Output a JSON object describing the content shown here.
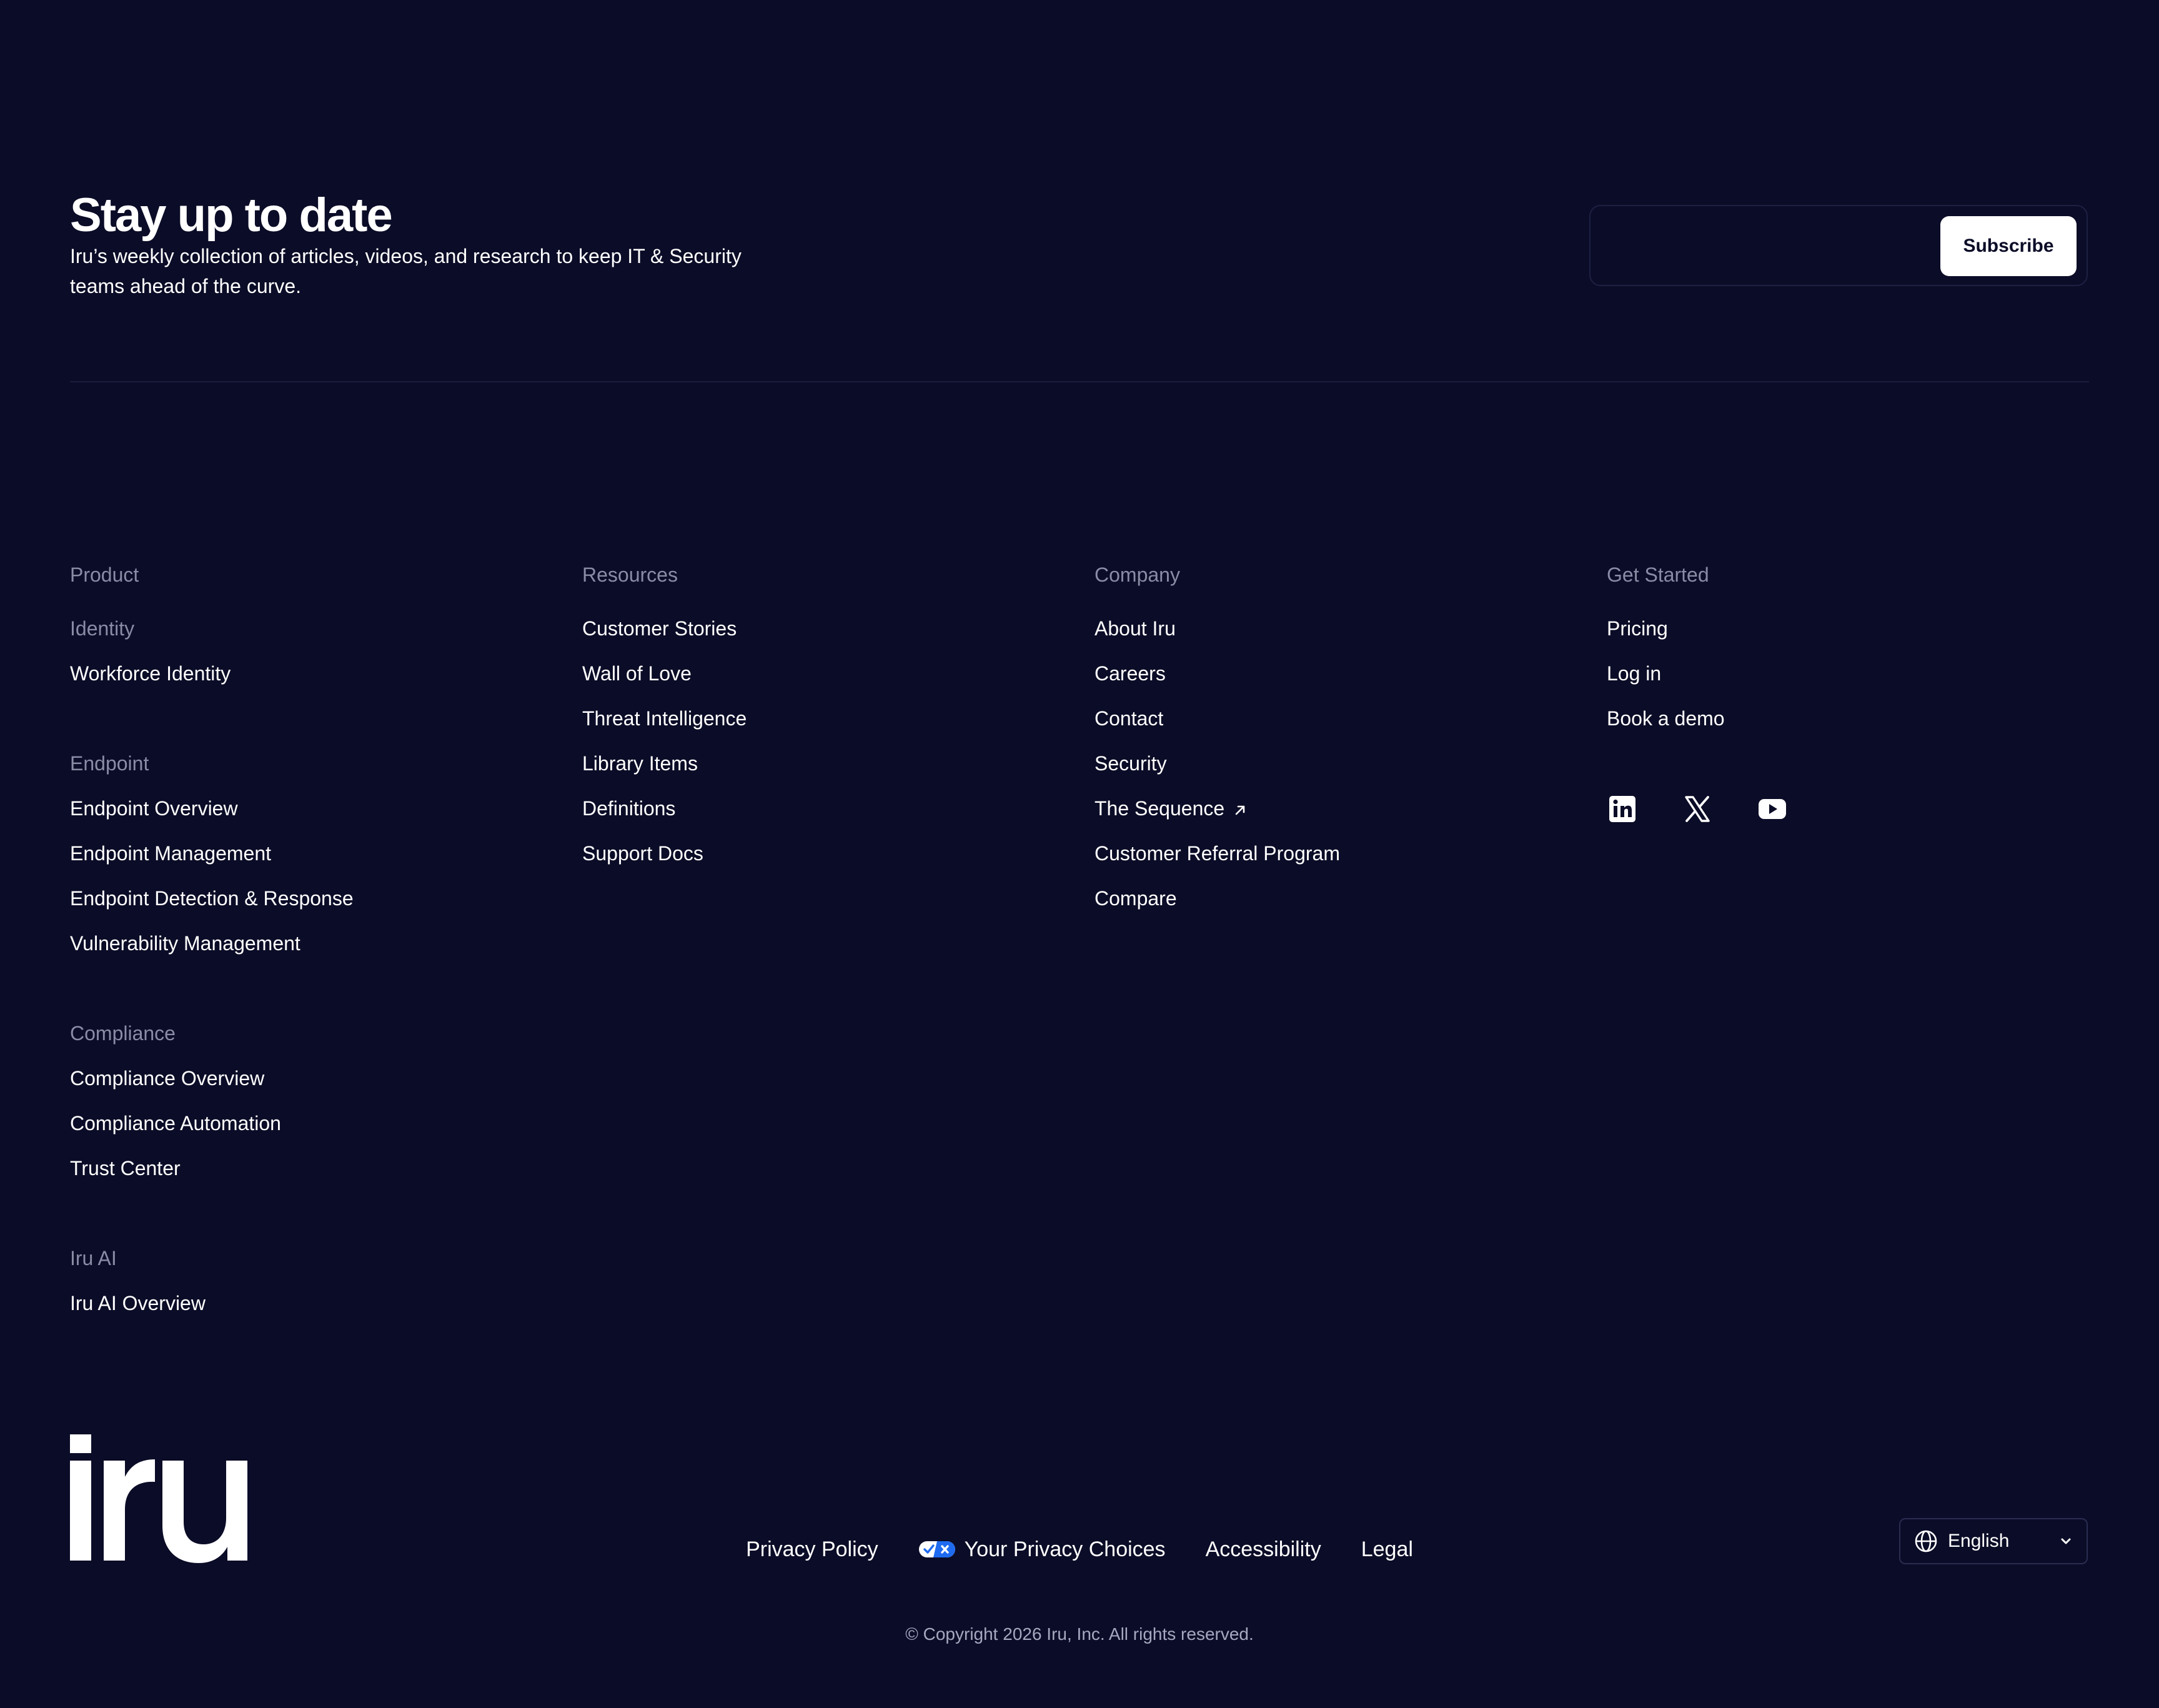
{
  "newsletter": {
    "title": "Stay up to date",
    "description": "Iru’s weekly collection of articles, videos, and research to keep IT & Security teams ahead of the curve.",
    "email_placeholder": "",
    "subscribe_label": "Subscribe"
  },
  "columns": {
    "product": {
      "heading": "Product",
      "groups": [
        {
          "heading": "Identity",
          "links": [
            "Workforce Identity"
          ]
        },
        {
          "heading": "Endpoint",
          "links": [
            "Endpoint Overview",
            "Endpoint Management",
            "Endpoint Detection & Response",
            "Vulnerability Management"
          ]
        },
        {
          "heading": "Compliance",
          "links": [
            "Compliance Overview",
            "Compliance Automation",
            "Trust Center"
          ]
        },
        {
          "heading": "Iru AI",
          "links": [
            "Iru AI Overview"
          ]
        }
      ]
    },
    "resources": {
      "heading": "Resources",
      "links": [
        "Customer Stories",
        "Wall of Love",
        "Threat Intelligence",
        "Library Items",
        "Definitions",
        "Support Docs"
      ]
    },
    "company": {
      "heading": "Company",
      "links": [
        "About Iru",
        "Careers",
        "Contact",
        "Security",
        "The Sequence",
        "Customer Referral Program",
        "Compare"
      ]
    },
    "get_started": {
      "heading": "Get Started",
      "links": [
        "Pricing",
        "Log in",
        "Book a demo"
      ]
    }
  },
  "social": {
    "icons": [
      "linkedin-icon",
      "x-icon",
      "youtube-icon"
    ]
  },
  "brand": {
    "logo_text": "iru"
  },
  "bottom": {
    "links": [
      "Privacy Policy",
      "Your Privacy Choices",
      "Accessibility",
      "Legal"
    ],
    "language": "English",
    "copyright": "© Copyright 2026 Iru, Inc. All rights reserved."
  },
  "colors": {
    "background": "#0b0c27",
    "muted_text": "#8a8ca6",
    "privacy_badge": "#1f6bf0"
  }
}
